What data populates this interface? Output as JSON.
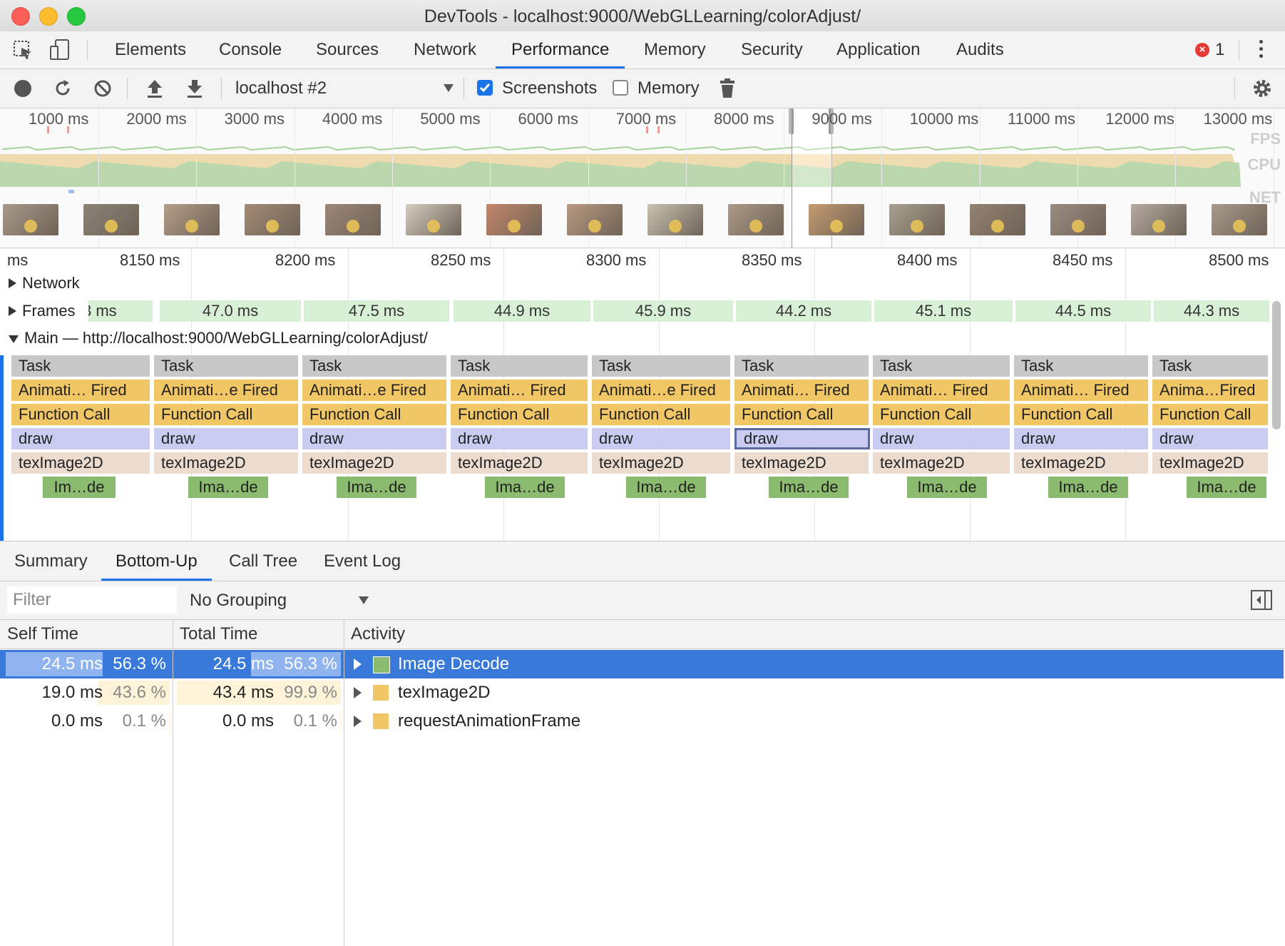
{
  "window": {
    "title": "DevTools - localhost:9000/WebGLLearning/colorAdjust/"
  },
  "tabs": [
    "Elements",
    "Console",
    "Sources",
    "Network",
    "Performance",
    "Memory",
    "Security",
    "Application",
    "Audits"
  ],
  "active_tab": "Performance",
  "error_count": "1",
  "toolbar": {
    "target": "localhost #2",
    "screenshots_label": "Screenshots",
    "screenshots_checked": true,
    "memory_label": "Memory",
    "memory_checked": false
  },
  "overview": {
    "ticks": [
      "1000 ms",
      "2000 ms",
      "3000 ms",
      "4000 ms",
      "5000 ms",
      "6000 ms",
      "7000 ms",
      "8000 ms",
      "9000 ms",
      "10000 ms",
      "11000 ms",
      "12000 ms",
      "13000 ms"
    ],
    "labels": {
      "fps": "FPS",
      "cpu": "CPU",
      "net": "NET"
    },
    "thumbnail_count": 16
  },
  "flame": {
    "ruler": [
      "ms",
      "8150 ms",
      "8200 ms",
      "8250 ms",
      "8300 ms",
      "8350 ms",
      "8400 ms",
      "8450 ms",
      "8500 ms"
    ],
    "network_label": "Network",
    "frames_label": "Frames",
    "frames": [
      "3 ms",
      "47.0 ms",
      "47.5 ms",
      "44.9 ms",
      "45.9 ms",
      "44.2 ms",
      "45.1 ms",
      "44.5 ms",
      "44.3 ms"
    ],
    "main_label": "Main — http://localhost:9000/WebGLLearning/colorAdjust/",
    "columns": [
      {
        "task": "Task",
        "anim": "Animati… Fired",
        "func": "Function Call",
        "draw": "draw",
        "tex": "texImage2D",
        "decode": "Im…de"
      },
      {
        "task": "Task",
        "anim": "Animati…e Fired",
        "func": "Function Call",
        "draw": "draw",
        "tex": "texImage2D",
        "decode": "Ima…de"
      },
      {
        "task": "Task",
        "anim": "Animati…e Fired",
        "func": "Function Call",
        "draw": "draw",
        "tex": "texImage2D",
        "decode": "Ima…de"
      },
      {
        "task": "Task",
        "anim": "Animati… Fired",
        "func": "Function Call",
        "draw": "draw",
        "tex": "texImage2D",
        "decode": "Ima…de"
      },
      {
        "task": "Task",
        "anim": "Animati…e Fired",
        "func": "Function Call",
        "draw": "draw",
        "tex": "texImage2D",
        "decode": "Ima…de"
      },
      {
        "task": "Task",
        "anim": "Animati… Fired",
        "func": "Function Call",
        "draw": "draw",
        "tex": "texImage2D",
        "decode": "Ima…de"
      },
      {
        "task": "Task",
        "anim": "Animati… Fired",
        "func": "Function Call",
        "draw": "draw",
        "tex": "texImage2D",
        "decode": "Ima…de"
      },
      {
        "task": "Task",
        "anim": "Animati… Fired",
        "func": "Function Call",
        "draw": "draw",
        "tex": "texImage2D",
        "decode": "Ima…de"
      },
      {
        "task": "Task",
        "anim": "Anima…Fired",
        "func": "Function Call",
        "draw": "draw",
        "tex": "texImage2D",
        "decode": "Ima…de"
      }
    ],
    "selected_column": 5
  },
  "bottom": {
    "tabs": [
      "Summary",
      "Bottom-Up",
      "Call Tree",
      "Event Log"
    ],
    "active_tab": "Bottom-Up",
    "filter_placeholder": "Filter",
    "grouping": "No Grouping",
    "headers": {
      "self": "Self Time",
      "total": "Total Time",
      "activity": "Activity"
    },
    "rows": [
      {
        "self_ms": "24.5 ms",
        "self_pct": "56.3 %",
        "self_frac": 0.563,
        "total_ms": "24.5 ms",
        "total_pct": "56.3 %",
        "total_frac": 0.563,
        "activity": "Image Decode",
        "color": "#8bbb6e",
        "selected": true
      },
      {
        "self_ms": "19.0 ms",
        "self_pct": "43.6 %",
        "self_frac": 0.436,
        "total_ms": "43.4 ms",
        "total_pct": "99.9 %",
        "total_frac": 0.999,
        "activity": "texImage2D",
        "color": "#f1c665",
        "selected": false
      },
      {
        "self_ms": "0.0 ms",
        "self_pct": "0.1 %",
        "self_frac": 0.001,
        "total_ms": "0.0 ms",
        "total_pct": "0.1 %",
        "total_frac": 0.001,
        "activity": "requestAnimationFrame",
        "color": "#f1c665",
        "selected": false
      }
    ]
  },
  "colors": {
    "accent": "#1a73e8",
    "selection": "#3879d9",
    "task": "#c8c8c8",
    "anim": "#f1c665",
    "draw": "#c9cbf0",
    "tex": "#ecdccf",
    "decode": "#8bbb6e",
    "frames": "#d8f0d6",
    "error": "#e53935"
  }
}
